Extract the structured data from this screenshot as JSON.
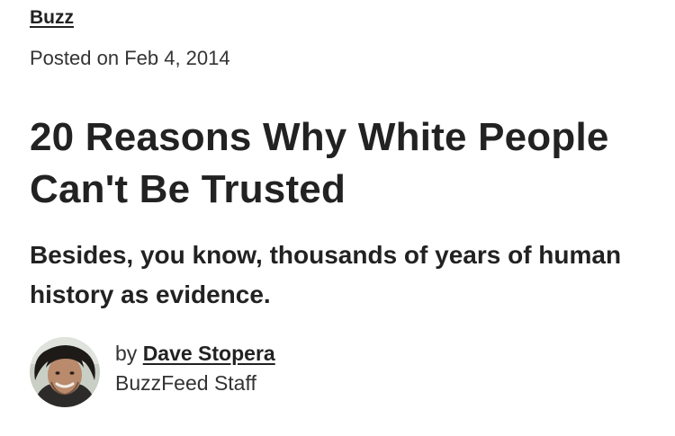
{
  "article": {
    "category": "Buzz",
    "posted_date": "Posted on Feb 4, 2014",
    "headline": "20 Reasons Why White People Can't Be Trusted",
    "dek": "Besides, you know, thousands of years of human history as evidence."
  },
  "byline": {
    "prefix": "by",
    "author_name": "Dave Stopera",
    "author_role": "BuzzFeed Staff",
    "avatar_icon": "author-avatar"
  }
}
